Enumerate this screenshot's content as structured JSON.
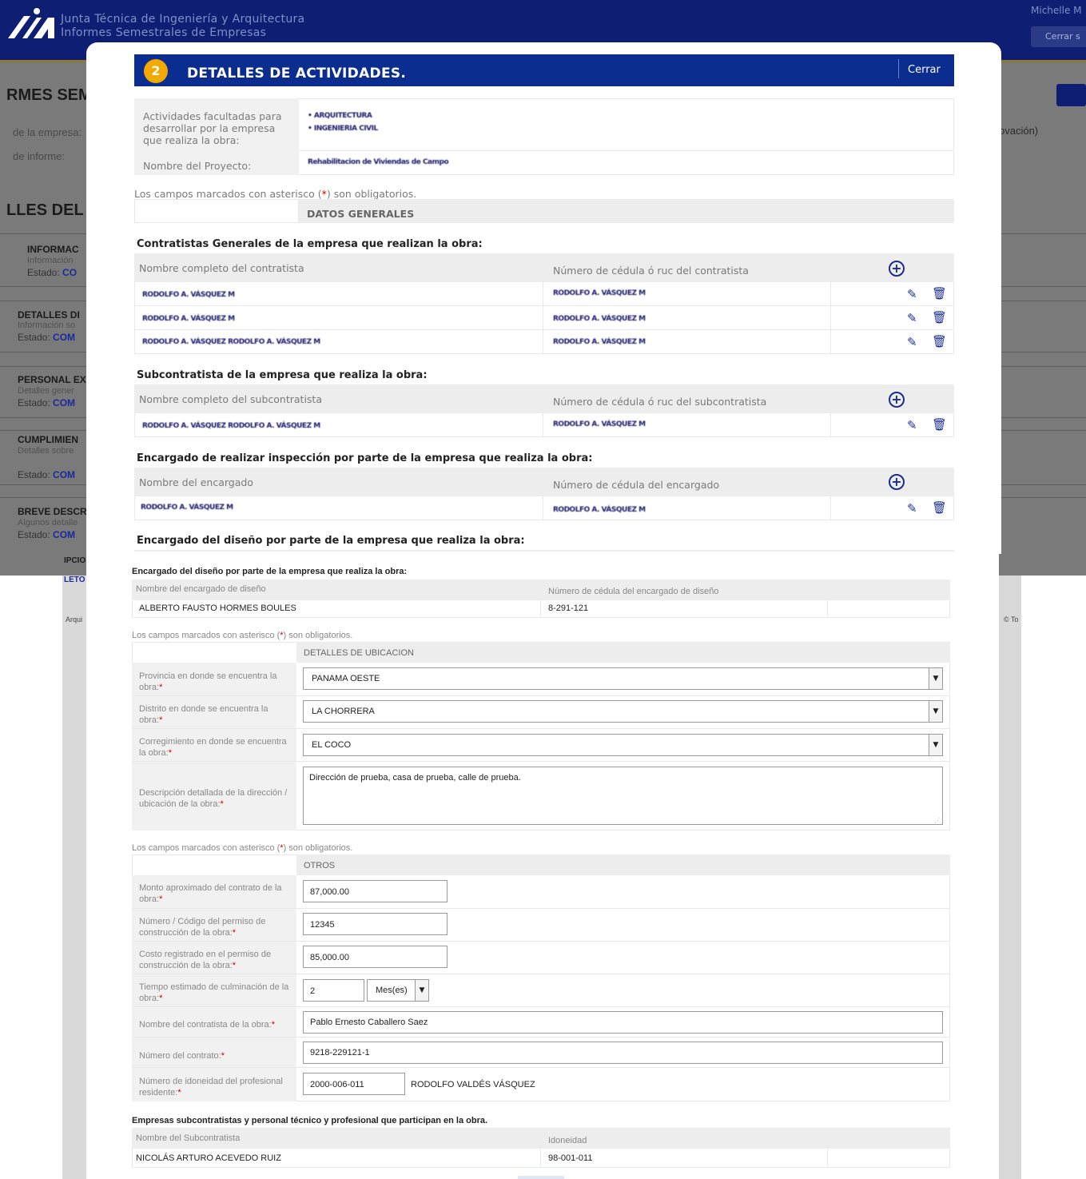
{
  "background": {
    "app_title_line1": "Junta Técnica de Ingeniería y Arquitectura",
    "app_title_line2": "Informes Semestrales de Empresas",
    "user_name": "Michelle M",
    "logout_label": "Cerrar s",
    "heading_partial": "RMES SEMI",
    "field_company_partial": "de la empresa:",
    "field_report_partial": "de informe:",
    "right_fragment": "ovación)",
    "heading2_partial": "LLES DEL I",
    "left_items": [
      {
        "title": "INFORMAC",
        "subtitle": "Información",
        "status_label": "Estado:",
        "status_value": "CO"
      },
      {
        "title": "DETALLES DI",
        "subtitle": "Información so",
        "status_label": "Estado:",
        "status_value": "COM"
      },
      {
        "title": "PERSONAL EX",
        "subtitle": "Detalles gener",
        "status_label": "Estado:",
        "status_value": "COM"
      },
      {
        "title": "CUMPLIMIEN",
        "subtitle": "Detalles sobre",
        "status_label": "Estado:",
        "status_value": "COM"
      },
      {
        "title": "BREVE DESCR",
        "subtitle": "Algunos detalle",
        "status_label": "Estado:",
        "status_value": "COM"
      }
    ],
    "bottom_fragment_1": "IPCIO",
    "bottom_fragment_2": "LETO",
    "footer_left": "Arqui",
    "footer_right": "© To"
  },
  "modal": {
    "step_number": "2",
    "title": "DETALLES DE ACTIVIDADES.",
    "close_label": "Cerrar",
    "activities_label": "Actividades facultadas para desarrollar por la empresa que realiza la obra:",
    "activities_values": [
      "• ARQUITECTURA",
      "• INGENIERIA CIVIL"
    ],
    "project_label": "Nombre del Proyecto:",
    "project_value": "Rehabilitacion de Viviendas de Campo",
    "required_note_prefix": "Los campos marcados con asterisco (",
    "required_note_ast": "*",
    "required_note_suffix": ") son obligatorios.",
    "general_data_header": "DATOS GENERALES",
    "contractors": {
      "title": "Contratistas Generales de la empresa que realizan la obra:",
      "col_name": "Nombre completo del contratista",
      "col_id": "Número de cédula ó ruc del contratista",
      "rows": [
        {
          "name": "RODOLFO A. VÁSQUEZ M",
          "id": "RODOLFO A. VÁSQUEZ M"
        },
        {
          "name": "RODOLFO A. VÁSQUEZ M",
          "id": "RODOLFO A. VÁSQUEZ M"
        },
        {
          "name": "RODOLFO A. VÁSQUEZ RODOLFO A. VÁSQUEZ M",
          "id": "RODOLFO A. VÁSQUEZ M"
        }
      ]
    },
    "subcontractors": {
      "title": "Subcontratista de la empresa que realiza la obra:",
      "col_name": "Nombre completo del subcontratista",
      "col_id": "Número de cédula ó ruc del subcontratista",
      "rows": [
        {
          "name": "RODOLFO A. VÁSQUEZ RODOLFO A. VÁSQUEZ M",
          "id": "RODOLFO A. VÁSQUEZ M"
        }
      ]
    },
    "inspector": {
      "title": "Encargado de realizar inspección por parte de la empresa que realiza la obra:",
      "col_name": "Nombre del encargado",
      "col_id": "Número de cédula del encargado",
      "rows": [
        {
          "name": "RODOLFO A. VÁSQUEZ M",
          "id": "RODOLFO A. VÁSQUEZ M"
        }
      ]
    },
    "designer_title_partial": "Encargado del diseño por parte de la empresa que realiza la obra:"
  },
  "continuation": {
    "designer": {
      "title": "Encargado del diseño por parte de la empresa que realiza la obra:",
      "col_name": "Nombre del encargado de diseño",
      "col_id": "Número de cédula del encargado de diseño",
      "name": "ALBERTO FAUSTO HORMES BOULES",
      "id": "8-291-121"
    },
    "required_note_prefix": "Los campos marcados con asterisco (",
    "required_note_ast": "*",
    "required_note_suffix": ") son obligatorios.",
    "location": {
      "header": "DETALLES DE UBICACION",
      "province_label": "Provincia en donde se encuentra la obra:",
      "province_value": "PANAMA OESTE",
      "district_label": "Distrito en donde se encuentra la obra:",
      "district_value": "LA CHORRERA",
      "corregimiento_label": "Corregimiento en donde se encuentra la obra:",
      "corregimiento_value": "EL COCO",
      "address_label": "Descripción detallada de la dirección / ubicación de la obra:",
      "address_value": "Dirección de prueba, casa de prueba, calle de prueba."
    },
    "others": {
      "header": "OTROS",
      "amount_label": "Monto aproximado del contrato de la obra:",
      "amount_value": "87,000.00",
      "permit_label": "Número / Código del permiso de construcción de la obra:",
      "permit_value": "12345",
      "cost_label": "Costo registrado en el permiso de construcción de la obra:",
      "cost_value": "85,000.00",
      "time_label": "Tiempo estimado de culminación de la obra:",
      "time_value": "2",
      "time_unit": "Mes(es)",
      "contractor_label": "Nombre del contratista de la obra:",
      "contractor_value": "Pablo Ernesto Caballero Saez",
      "contract_label": "Número del contrato:",
      "contract_value": "9218-229121-1",
      "resident_label": "Número de idoneidad del profesional residente:",
      "resident_value": "2000-006-011",
      "resident_name": "RODOLFO VALDÉS VÁSQUEZ"
    },
    "companies": {
      "title": "Empresas subcontratistas y personal técnico y profesional que participan en la obra.",
      "col_name": "Nombre del Subcontratista",
      "col_id": "Idoneidad",
      "name": "NICOLÁS ARTURO ACEVEDO RUIZ",
      "id": "98-001-011"
    }
  },
  "colors": {
    "header_blue": "#0e1f73",
    "modal_blue": "#0b2d8f",
    "step_badge": "#f2a900",
    "required_red": "#cc0000"
  }
}
